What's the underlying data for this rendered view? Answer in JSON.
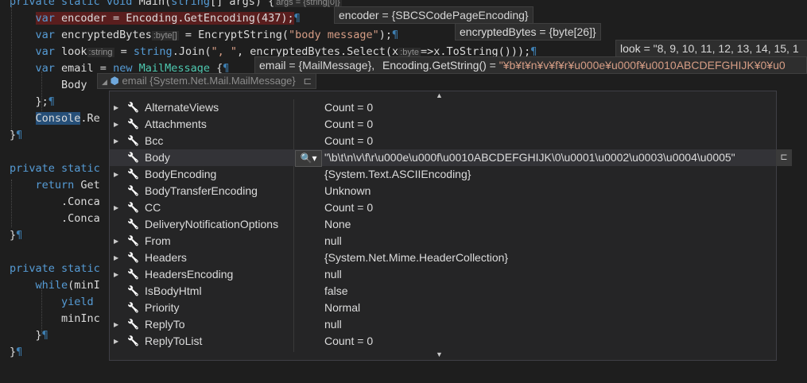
{
  "code": {
    "lines": [
      {
        "html": "<span class=\"kw\">private static void</span> Main(<span class=\"kw\">string</span>[] args) {<span class=\"hint\">args = {string[0]}</span>"
      },
      {
        "html": "    <span style=\"background:#5a1e1e;\"><span class=\"kw\">var</span> encoder = Encoding.GetEncoding(437);</span><span class=\"pil\">¶</span>"
      },
      {
        "html": "    <span class=\"kw\">var</span> encryptedBytes<span class=\"hint\">:byte[]</span> = EncryptString(<span class=\"st\">\"body message\"</span>);<span class=\"pil\">¶</span>"
      },
      {
        "html": "    <span class=\"kw\">var</span> look<span class=\"hint\">:string</span> = <span class=\"kw\">string</span>.Join(<span class=\"st\">\", \"</span>, encryptedBytes.Select(x<span class=\"hint\">:byte</span>=&gt;x.ToString()));<span class=\"pil\">¶</span>"
      },
      {
        "html": "    <span class=\"kw\">var</span> email = <span class=\"kw\">new</span> <span class=\"ty\">MailMessage</span> {<span class=\"pil\">¶</span>"
      },
      {
        "html": "        Body"
      },
      {
        "html": "    };<span class=\"pil\">¶</span>"
      },
      {
        "html": "    <span style=\"background:#264f78;\">Console</span>.Re"
      },
      {
        "html": "}<span class=\"pil\">¶</span>"
      },
      {
        "html": ""
      },
      {
        "html": "<span class=\"kw\">private static</span>"
      },
      {
        "html": "    <span class=\"kw\">return</span> Get"
      },
      {
        "html": "        .Conca"
      },
      {
        "html": "        .Conca"
      },
      {
        "html": "}<span class=\"pil\">¶</span>"
      },
      {
        "html": ""
      },
      {
        "html": "<span class=\"kw\">private static</span>"
      },
      {
        "html": "    <span class=\"kw\">while</span>(minI"
      },
      {
        "html": "        <span class=\"kw\">yield</span>"
      },
      {
        "html": "        minInc"
      },
      {
        "html": "    }<span class=\"pil\">¶</span>"
      },
      {
        "html": "}<span class=\"pil\">¶</span>"
      }
    ]
  },
  "datatips": {
    "encoder": {
      "name": "encoder",
      "value": "{SBCSCodePageEncoding}"
    },
    "encryptedBytes": {
      "name": "encryptedBytes",
      "value": "{byte[26]}"
    },
    "look": {
      "name": "look",
      "value": "\"8, 9, 10, 11, 12, 13, 14, 15, 1"
    },
    "email": {
      "name": "email",
      "value": "{MailMessage}",
      "extra_name": "Encoding.GetString()",
      "extra_value": "\"¥b¥t¥n¥v¥f¥r¥u000e¥u000f¥u0010ABCDEFGHIJK¥0¥u0"
    }
  },
  "hover_tip": {
    "name": "email",
    "type": "{System.Net.Mail.MailMessage}"
  },
  "properties": [
    {
      "name": "AlternateViews",
      "value": "Count = 0",
      "expandable": true
    },
    {
      "name": "Attachments",
      "value": "Count = 0",
      "expandable": true
    },
    {
      "name": "Bcc",
      "value": "Count = 0",
      "expandable": true
    },
    {
      "name": "Body",
      "value": "\"\\b\\t\\n\\v\\f\\r\\u000e\\u000f\\u0010ABCDEFGHIJK\\0\\u0001\\u0002\\u0003\\u0004\\u0005\"",
      "expandable": false,
      "selected": true
    },
    {
      "name": "BodyEncoding",
      "value": "{System.Text.ASCIIEncoding}",
      "expandable": true
    },
    {
      "name": "BodyTransferEncoding",
      "value": "Unknown",
      "expandable": false
    },
    {
      "name": "CC",
      "value": "Count = 0",
      "expandable": true
    },
    {
      "name": "DeliveryNotificationOptions",
      "value": "None",
      "expandable": false
    },
    {
      "name": "From",
      "value": "null",
      "expandable": true
    },
    {
      "name": "Headers",
      "value": "{System.Net.Mime.HeaderCollection}",
      "expandable": true
    },
    {
      "name": "HeadersEncoding",
      "value": "null",
      "expandable": true
    },
    {
      "name": "IsBodyHtml",
      "value": "false",
      "expandable": false
    },
    {
      "name": "Priority",
      "value": "Normal",
      "expandable": false
    },
    {
      "name": "ReplyTo",
      "value": "null",
      "expandable": true
    },
    {
      "name": "ReplyToList",
      "value": "Count = 0",
      "expandable": true
    }
  ],
  "icons": {
    "wrench": "wrench-icon",
    "expand": "expand-arrow-icon",
    "magnifier": "magnifier-icon",
    "pin": "pin-icon"
  }
}
